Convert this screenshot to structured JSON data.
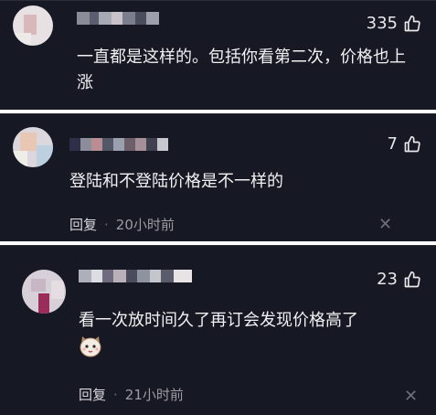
{
  "comments": [
    {
      "likes": "335",
      "text": "一直都是这样的。包括你看第二次，价格也上涨"
    },
    {
      "likes": "7",
      "text": "登陆和不登陆价格是不一样的",
      "reply_label": "回复",
      "dot": "·",
      "time": "20小时前",
      "close": "✕"
    },
    {
      "likes": "23",
      "text": "看一次放时间久了再订会发现价格高了",
      "reply_label": "回复",
      "dot": "·",
      "time": "21小时前",
      "close": "✕"
    }
  ],
  "icons": {
    "like": "thumbs-up-icon",
    "emoji": "cat-face-emoji"
  },
  "colors": {
    "bg": "#161823",
    "text": "#f1f1f3",
    "meta": "#9a9ba3"
  }
}
